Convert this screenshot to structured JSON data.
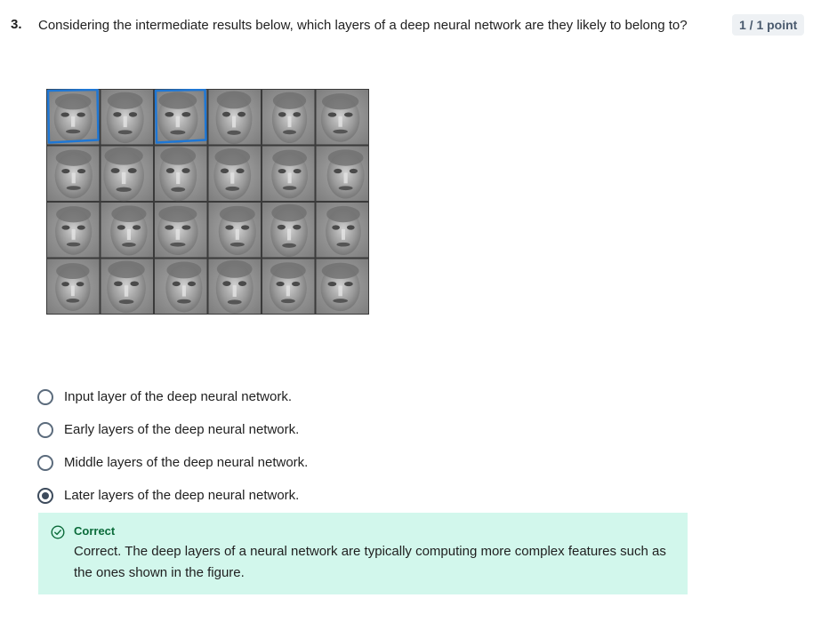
{
  "question": {
    "number": "3.",
    "text": "Considering the intermediate results below, which layers of a deep neural network are they likely to belong to?",
    "points": "1 / 1 point"
  },
  "figure": {
    "grid_rows": 4,
    "grid_cols": 6,
    "highlighted_cells": [
      [
        0,
        0
      ],
      [
        0,
        2
      ]
    ],
    "highlight_color": "#1f77d4"
  },
  "options": [
    {
      "label": "Input layer of the deep neural network.",
      "selected": false
    },
    {
      "label": "Early layers of the deep neural network.",
      "selected": false
    },
    {
      "label": "Middle layers of the deep neural network.",
      "selected": false
    },
    {
      "label": "Later layers of the deep neural network.",
      "selected": true
    }
  ],
  "feedback": {
    "status": "Correct",
    "text": "Correct. The deep layers of a neural network are typically computing more complex features such as the ones shown in the figure.",
    "icon": "check-circle-icon",
    "color": "#0b6b3a",
    "background": "#d2f7ec"
  }
}
